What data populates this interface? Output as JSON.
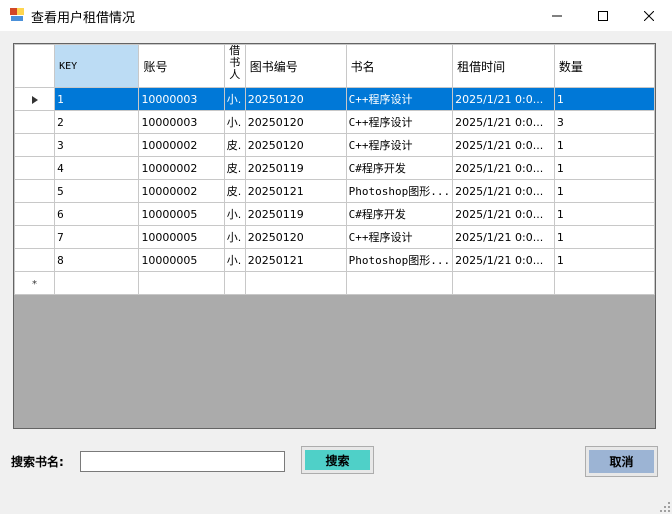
{
  "window": {
    "title": "查看用户租借情况"
  },
  "grid": {
    "columns": [
      "KEY",
      "账号",
      "借书人",
      "图书编号",
      "书名",
      "租借时间",
      "数量"
    ],
    "rows": [
      {
        "key": "1",
        "account": "10000003",
        "borrower": "小.",
        "book_id": "20250120",
        "book_name": "C++程序设计",
        "time": "2025/1/21 0:0...",
        "qty": "1"
      },
      {
        "key": "2",
        "account": "10000003",
        "borrower": "小.",
        "book_id": "20250120",
        "book_name": "C++程序设计",
        "time": "2025/1/21 0:0...",
        "qty": "3"
      },
      {
        "key": "3",
        "account": "10000002",
        "borrower": "皮.",
        "book_id": "20250120",
        "book_name": "C++程序设计",
        "time": "2025/1/21 0:0...",
        "qty": "1"
      },
      {
        "key": "4",
        "account": "10000002",
        "borrower": "皮.",
        "book_id": "20250119",
        "book_name": "C#程序开发",
        "time": "2025/1/21 0:0...",
        "qty": "1"
      },
      {
        "key": "5",
        "account": "10000002",
        "borrower": "皮.",
        "book_id": "20250121",
        "book_name": "Photoshop图形...",
        "time": "2025/1/21 0:0...",
        "qty": "1"
      },
      {
        "key": "6",
        "account": "10000005",
        "borrower": "小.",
        "book_id": "20250119",
        "book_name": "C#程序开发",
        "time": "2025/1/21 0:0...",
        "qty": "1"
      },
      {
        "key": "7",
        "account": "10000005",
        "borrower": "小.",
        "book_id": "20250120",
        "book_name": "C++程序设计",
        "time": "2025/1/21 0:0...",
        "qty": "1"
      },
      {
        "key": "8",
        "account": "10000005",
        "borrower": "小.",
        "book_id": "20250121",
        "book_name": "Photoshop图形...",
        "time": "2025/1/21 0:0...",
        "qty": "1"
      }
    ],
    "selected_row": 0
  },
  "search": {
    "label": "搜索书名:",
    "value": "",
    "button_label": "搜索"
  },
  "cancel_button_label": "取消",
  "colors": {
    "selection": "#0078d7",
    "key_header": "#bcdcf4",
    "search_button": "#4fd0c8",
    "cancel_button": "#9cb4d4",
    "grid_empty_area": "#ababab"
  }
}
